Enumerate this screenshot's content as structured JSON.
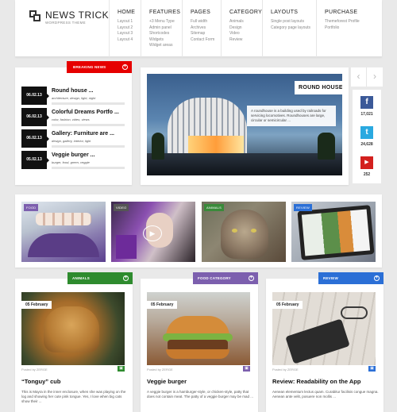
{
  "brand": {
    "title": "NEWS TRICK",
    "subtitle": "WORDPRESS THEME"
  },
  "nav": [
    {
      "title": "HOME",
      "items": [
        "Layout 1",
        "Layout 2",
        "Layout 3",
        "Layout 4"
      ]
    },
    {
      "title": "FEATURES",
      "items": [
        "+3 Menu Type",
        "Admin panel",
        "Shortcodes",
        "Widgets",
        "Widget areas"
      ]
    },
    {
      "title": "PAGES",
      "items": [
        "Full width",
        "Archives",
        "Sitemap",
        "Contact Form"
      ]
    },
    {
      "title": "CATEGORY",
      "items": [
        "Animals",
        "Design",
        "Video",
        "Review"
      ]
    },
    {
      "title": "LAYOUTS",
      "items": [
        "Single post layouts",
        "Category page layouts"
      ]
    },
    {
      "title": "PURCHASE",
      "items": [
        "Themeforest Profile",
        "Portfolio"
      ]
    }
  ],
  "breaking": {
    "label": "BREAKING NEWS",
    "items": [
      {
        "date": "06.02.13",
        "title": "Round house ...",
        "tags": "architecture, design, light, night"
      },
      {
        "date": "06.02.13",
        "title": "Colorful Dreams Portfo ...",
        "tags": "color, fashion, video, views"
      },
      {
        "date": "06.02.13",
        "title": "Gallery: Furniture are ...",
        "tags": "design, gallery, interior, light"
      },
      {
        "date": "05.02.13",
        "title": "Veggie burger ...",
        "tags": "burger, food, green, veggie"
      }
    ]
  },
  "feature": {
    "title": "ROUND HOUSE",
    "description": "A roundhouse is a building used by railroads for servicing locomotives. Roundhouses are large, circular or semicircular ..."
  },
  "slider": {
    "prev": "‹",
    "next": "›"
  },
  "social": [
    {
      "icon": "f",
      "count": "17,021",
      "color": "#3b5998",
      "name": "facebook-icon"
    },
    {
      "icon": "t",
      "count": "24,628",
      "color": "#2aa9e0",
      "name": "twitter-icon"
    },
    {
      "icon": "▶",
      "count": "252",
      "color": "#d3201e",
      "name": "youtube-icon"
    }
  ],
  "categories": [
    {
      "label": "FOOD",
      "color": "#7c5fae"
    },
    {
      "label": "VIDEO",
      "color": "#555555"
    },
    {
      "label": "ANIMALS",
      "color": "#3a8a3a"
    },
    {
      "label": "REVIEW",
      "color": "#2b6fd6"
    }
  ],
  "cards": [
    {
      "tag": "ANIMALS",
      "tag_color": "#2e8b2e",
      "date": "05 February",
      "byline": "Posted by ZERGE",
      "title": "“Tonguy” cub",
      "text": "This is Mayra in the inner enclosure, when she was playing on the log and showing her cute pink tongue. Yes, I love when big cats show their ..."
    },
    {
      "tag": "FOOD CATEGORY",
      "tag_color": "#7c5fae",
      "date": "05 February",
      "byline": "Posted by ZERGE",
      "title": "Veggie burger",
      "text": "A veggie burger is a hamburger-style, or chicken-style, patty that does not contain meat. The patty of a veggie burger may be mad ..."
    },
    {
      "tag": "REVIEW",
      "tag_color": "#2b6fd6",
      "date": "05 February",
      "byline": "Posted by ZERGE",
      "title": "Review: Readability on the App",
      "text": "Aenean elementum lectus quam. Curabitur facilisis congue magna. Aenean ante velit, posuere non mollis ..."
    }
  ],
  "tag_plus": "+",
  "camera_icon": "▣"
}
